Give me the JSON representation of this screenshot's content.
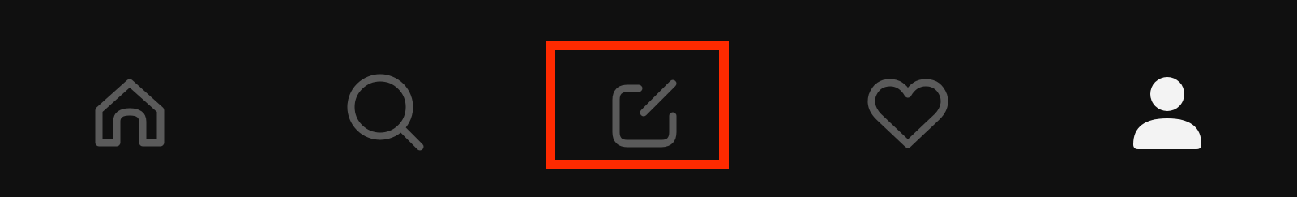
{
  "nav": {
    "items": [
      {
        "id": "home",
        "icon": "home-icon",
        "label": ""
      },
      {
        "id": "search",
        "icon": "search-icon",
        "label": ""
      },
      {
        "id": "compose",
        "icon": "compose-icon",
        "label": ""
      },
      {
        "id": "likes",
        "icon": "heart-icon",
        "label": ""
      },
      {
        "id": "profile",
        "icon": "person-icon",
        "label": ""
      }
    ],
    "active": "profile",
    "highlighted": "compose"
  },
  "colors": {
    "background": "#101010",
    "icon_inactive": "#5a5a5a",
    "icon_active": "#f3f3f3",
    "highlight": "#ff2a00"
  }
}
